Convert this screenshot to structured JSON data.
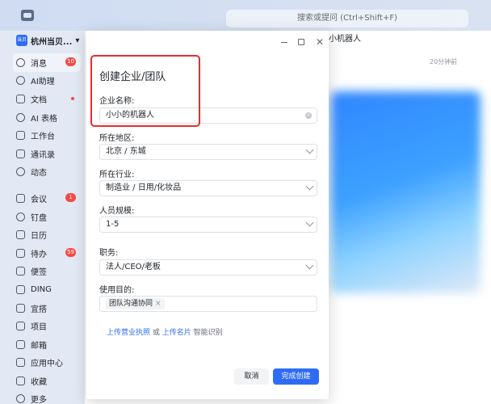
{
  "topbar": {
    "search_placeholder": "搜索或提问 (Ctrl+Shift+F)"
  },
  "org": {
    "avatar_text": "当贝",
    "name": "杭州当贝...",
    "dropdown_glyph": "▾"
  },
  "sidebar": {
    "items": [
      {
        "label": "消息",
        "badge": "10"
      },
      {
        "label": "AI助理"
      },
      {
        "label": "文档",
        "dot": true
      },
      {
        "label": "AI 表格"
      },
      {
        "label": "工作台"
      },
      {
        "label": "通讯录"
      },
      {
        "label": "动态"
      },
      {
        "label": "会议",
        "badge": "1"
      },
      {
        "label": "钉盘"
      },
      {
        "label": "日历"
      },
      {
        "label": "待办",
        "badge": "59"
      },
      {
        "label": "便签"
      },
      {
        "label": "DING"
      },
      {
        "label": "宜搭"
      },
      {
        "label": "项目"
      },
      {
        "label": "邮箱"
      },
      {
        "label": "应用中心"
      },
      {
        "label": "收藏"
      },
      {
        "label": "更多"
      }
    ]
  },
  "chat": {
    "title": "小机器人",
    "time": "20分钟前"
  },
  "modal": {
    "title": "创建企业/团队",
    "company_name_label": "企业名称:",
    "company_name_value": "小小的机器人",
    "region_label": "所在地区:",
    "region_value": "北京 / 东城",
    "industry_label": "所在行业:",
    "industry_value": "制造业 / 日用/化妆品",
    "size_label": "人员规模:",
    "size_value": "1-5",
    "role_label": "职务:",
    "role_value": "法人/CEO/老板",
    "purpose_label": "使用目的:",
    "purpose_tag": "团队沟通协同",
    "purpose_tag_remove": "×",
    "upload_license": "上传营业执照",
    "upload_or": " 或 ",
    "upload_card": "上传名片",
    "upload_suffix": " 智能识别",
    "cancel_label": "取消",
    "confirm_label": "完成创建",
    "close_glyph": "✕"
  }
}
